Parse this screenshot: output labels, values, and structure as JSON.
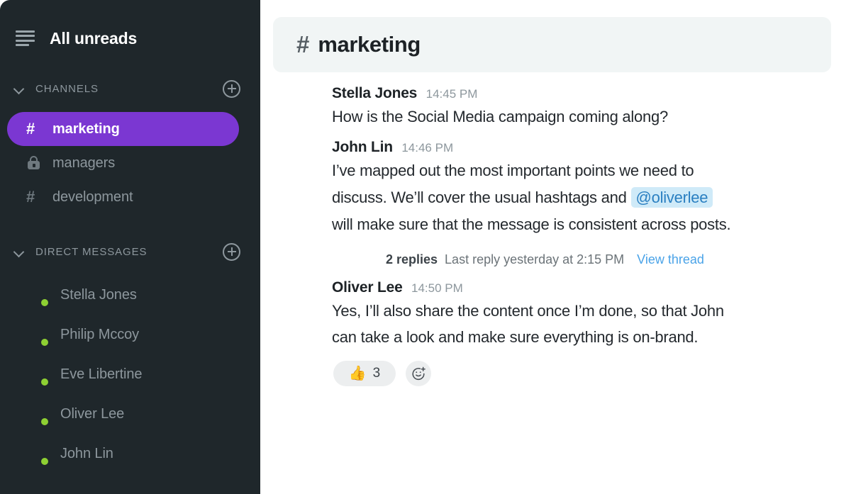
{
  "sidebar": {
    "menu_icon": "hamburger-icon",
    "title": "All unreads",
    "channels_section": {
      "label": "CHANNELS",
      "add_icon": "plus-circle-icon",
      "collapse_icon": "chevron-down-icon",
      "items": [
        {
          "name": "marketing",
          "icon": "hash-icon",
          "active": true
        },
        {
          "name": "managers",
          "icon": "lock-icon",
          "active": false
        },
        {
          "name": "development",
          "icon": "hash-icon",
          "active": false
        }
      ]
    },
    "dm_section": {
      "label": "DIRECT MESSAGES",
      "add_icon": "plus-circle-icon",
      "collapse_icon": "chevron-down-icon",
      "items": [
        {
          "name": "Stella Jones",
          "status": "online",
          "avatar": "av-stella"
        },
        {
          "name": "Philip Mccoy",
          "status": "online",
          "avatar": "av-philip"
        },
        {
          "name": "Eve Libertine",
          "status": "online",
          "avatar": "av-eve"
        },
        {
          "name": "Oliver Lee",
          "status": "online",
          "avatar": "av-oliver"
        },
        {
          "name": "John Lin",
          "status": "online",
          "avatar": "av-john"
        }
      ]
    }
  },
  "header": {
    "hash": "#",
    "channel_name": "marketing"
  },
  "messages": [
    {
      "author": "Stella Jones",
      "time": "14:45 PM",
      "avatar": "av-stella",
      "text_1": "How is the Social Media campaign coming along?",
      "text_2": "",
      "text_3": "",
      "mention": ""
    },
    {
      "author": "John Lin",
      "time": "14:46 PM",
      "avatar": "av-john",
      "text_1": "I’ve mapped out the most important points we need to",
      "text_2": "discuss. We’ll cover the usual hashtags and ",
      "mention": "@oliverlee",
      "text_3": "will make sure that the message is consistent across posts.",
      "thread": {
        "count_label": "2 replies",
        "last_reply": "Last reply yesterday at 2:15 PM",
        "link_label": "View thread",
        "face_avatars": [
          "av-oliver",
          "av-john"
        ]
      }
    },
    {
      "author": "Oliver Lee",
      "time": "14:50 PM",
      "avatar": "av-oliver",
      "text_1": "Yes, I’ll also share the content once I’m done, so that John",
      "text_2": "can take a look and make sure everything is on-brand.",
      "text_3": "",
      "mention": "",
      "reactions": {
        "items": [
          {
            "emoji": "👍",
            "count": "3"
          }
        ],
        "add_icon": "add-reaction-icon"
      }
    }
  ],
  "colors": {
    "sidebar_bg": "#1f272b",
    "active_channel": "#7b37d2",
    "header_bg": "#f1f5f5",
    "mention_bg": "#cfeaf8",
    "mention_text": "#2a7fc1",
    "link": "#4aa3e8",
    "online": "#8ed033"
  }
}
